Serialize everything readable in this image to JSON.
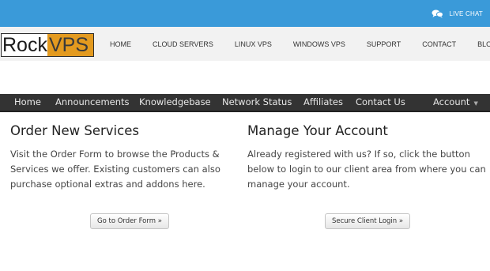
{
  "topbar": {
    "livechat_label": "LIVE CHAT"
  },
  "logo": {
    "part_a": "Rock",
    "part_b": "VPS"
  },
  "mainnav": {
    "items": [
      "HOME",
      "CLOUD SERVERS",
      "LINUX VPS",
      "WINDOWS VPS",
      "SUPPORT",
      "CONTACT",
      "BLOG"
    ]
  },
  "menubar": {
    "items": [
      "Home",
      "Announcements",
      "Knowledgebase",
      "Network Status",
      "Affiliates",
      "Contact Us"
    ],
    "account_label": "Account"
  },
  "order": {
    "title": "Order New Services",
    "lines": [
      "Visit the Order Form to browse the Products &",
      "Services we offer. Existing customers can also",
      "purchase optional extras and addons here."
    ],
    "button_label": "Go to Order Form »"
  },
  "account": {
    "title": "Manage Your Account",
    "lines": [
      "Already registered with us? If so, click the button",
      "below to login to our client area from where you can",
      "manage your account."
    ],
    "button_label": "Secure Client Login »"
  },
  "colors": {
    "topbar": "#3a9ad9",
    "menubar": "#333333",
    "logo_accent": "#e39a1f"
  }
}
